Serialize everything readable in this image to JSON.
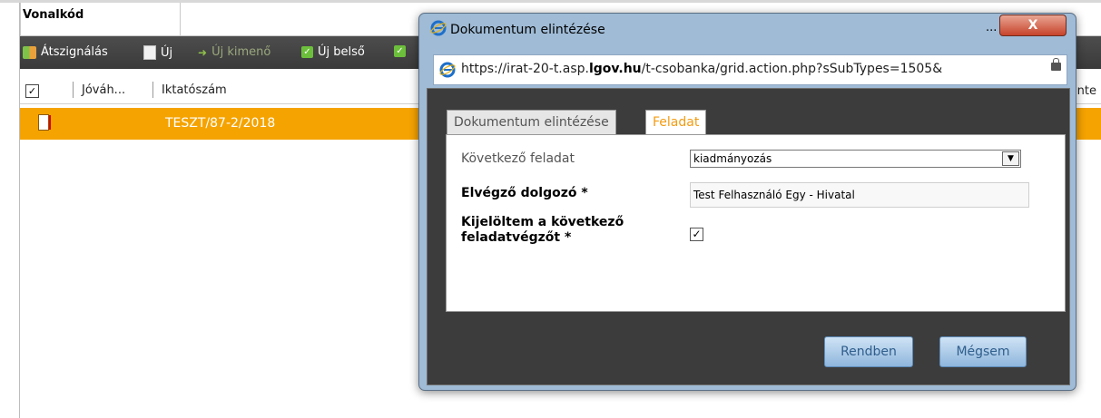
{
  "app": {
    "tab_label": "Vonalkód",
    "toolbar": {
      "assign_label": "Átszignálás",
      "new_label": "Új",
      "new_outgoing_label": "Új kimenő",
      "new_internal_label": "Új belső"
    },
    "table": {
      "headers": [
        "Jóváh...",
        "Iktatószám"
      ],
      "right_header_fragment": "inte",
      "rows": [
        {
          "iktatoszam": "TESZT/87-2/2018",
          "selected": true
        }
      ]
    }
  },
  "dialog": {
    "title": "Dokumentum elintézése",
    "title_dots": "...",
    "close_label": "X",
    "address": {
      "url_prefix": "https://irat-20-t.asp.",
      "url_domain": "lgov.hu",
      "url_suffix": "/t-csobanka/grid.action.php?sSubTypes=1505&"
    },
    "tabs": [
      {
        "label": "Dokumentum elintézése",
        "active": false
      },
      {
        "label": "Feladat",
        "active": true
      }
    ],
    "form": {
      "next_task_label": "Következő feladat",
      "next_task_value": "kiadmányozás",
      "worker_label": "Elvégző dolgozó *",
      "worker_value": "Test Felhasználó Egy - Hivatal",
      "selected_label_line1": "Kijelöltem a következő",
      "selected_label_line2": "feladatvégzőt *",
      "selected_checked": true
    },
    "buttons": {
      "ok_label": "Rendben",
      "cancel_label": "Mégsem"
    }
  },
  "colors": {
    "selected_row": "#f5a300",
    "toolbar_bg": "#3f3f3f",
    "active_tab_text": "#f39c12",
    "dialog_frame": "#9fbbd6",
    "button": "#a9c8e8"
  }
}
